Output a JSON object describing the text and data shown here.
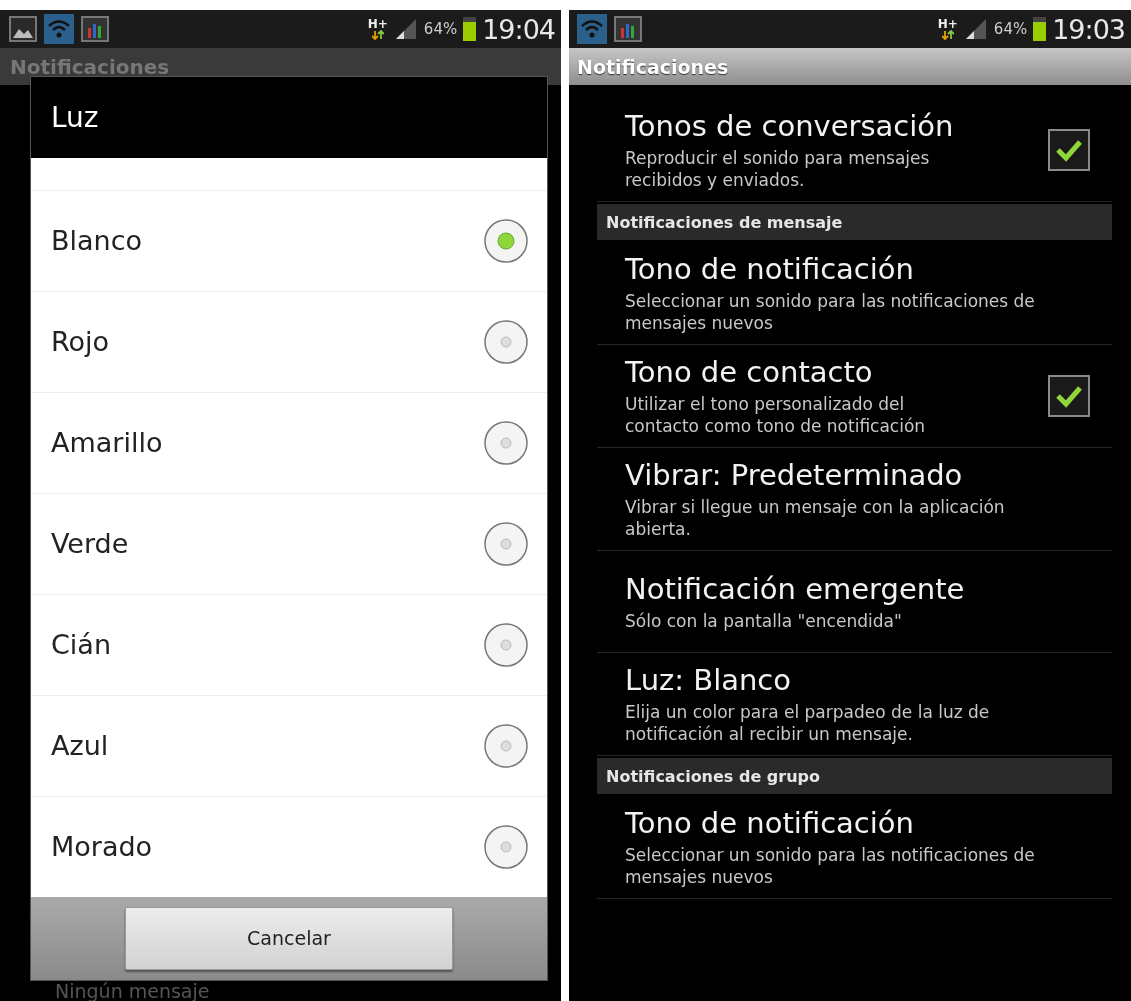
{
  "screens": [
    {
      "kind": "dialog",
      "status_bar": {
        "notification_icons": [
          {
            "kind": "image"
          },
          {
            "kind": "wifi"
          },
          {
            "kind": "chart"
          }
        ],
        "network": "H+",
        "battery": "64%",
        "time": "19:04"
      },
      "background": {
        "header": "Notificaciones",
        "footer": "Ningún mensaje"
      },
      "dialog": {
        "title": "Luz",
        "options": [
          {
            "label": "Blanco",
            "selected": true
          },
          {
            "label": "Rojo",
            "selected": false
          },
          {
            "label": "Amarillo",
            "selected": false
          },
          {
            "label": "Verde",
            "selected": false
          },
          {
            "label": "Cián",
            "selected": false
          },
          {
            "label": "Azul",
            "selected": false
          },
          {
            "label": "Morado",
            "selected": false
          }
        ],
        "button": "Cancelar"
      }
    },
    {
      "kind": "settings",
      "status_bar": {
        "notification_icons": [
          {
            "kind": "wifi"
          },
          {
            "kind": "chart"
          }
        ],
        "network": "H+",
        "battery": "64%",
        "time": "19:03"
      },
      "header": "Notificaciones",
      "items": [
        {
          "kind": "check",
          "title": "Tonos de conversación",
          "summary": "Reproducir el sonido para mensajes recibidos y enviados.",
          "checked": true
        },
        {
          "kind": "section",
          "title": "Notificaciones de mensaje"
        },
        {
          "kind": "plain",
          "title": "Tono de notificación",
          "summary": "Seleccionar un sonido para las notificaciones de mensajes nuevos"
        },
        {
          "kind": "check",
          "title": "Tono de contacto",
          "summary": "Utilizar el tono personalizado del contacto como tono de notificación",
          "checked": true
        },
        {
          "kind": "plain",
          "title": "Vibrar: Predeterminado",
          "summary": "Vibrar si llegue un mensaje con la aplicación abierta."
        },
        {
          "kind": "plain",
          "title": "Notificación emergente",
          "summary": "Sólo con la pantalla \"encendida\""
        },
        {
          "kind": "plain",
          "title": "Luz: Blanco",
          "summary": "Elija un color para el parpadeo de la luz de notificación al recibir un mensaje."
        },
        {
          "kind": "section",
          "title": "Notificaciones de grupo"
        },
        {
          "kind": "plain",
          "title": "Tono de notificación",
          "summary": "Seleccionar un sonido para las notificaciones de mensajes nuevos"
        }
      ]
    }
  ]
}
